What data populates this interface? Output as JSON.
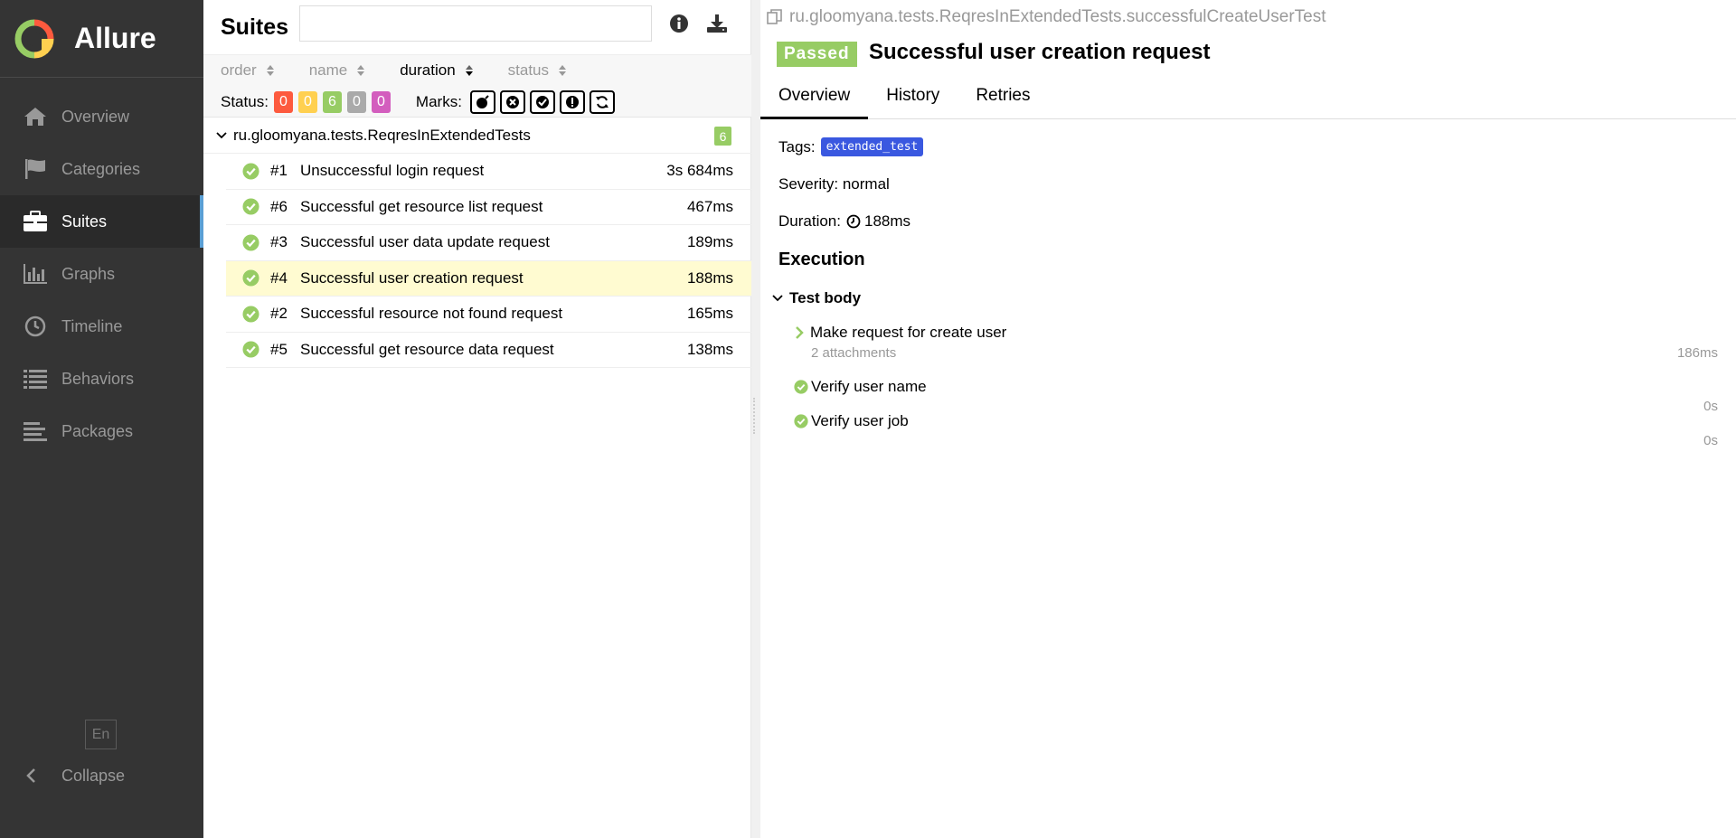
{
  "sidebar": {
    "brand": "Allure",
    "items": [
      {
        "label": "Overview",
        "icon": "home-icon"
      },
      {
        "label": "Categories",
        "icon": "flag-icon"
      },
      {
        "label": "Suites",
        "icon": "briefcase-icon",
        "active": true
      },
      {
        "label": "Graphs",
        "icon": "bar-chart-icon"
      },
      {
        "label": "Timeline",
        "icon": "clock-icon"
      },
      {
        "label": "Behaviors",
        "icon": "list-icon"
      },
      {
        "label": "Packages",
        "icon": "align-left-icon"
      }
    ],
    "language": "En",
    "collapse": "Collapse"
  },
  "suites": {
    "title": "Suites",
    "search_placeholder": "",
    "sort": {
      "order": "order",
      "name": "name",
      "duration": "duration",
      "status": "status"
    },
    "status_label": "Status:",
    "status_counts": [
      {
        "value": "0",
        "color": "#fd5a3e"
      },
      {
        "value": "0",
        "color": "#ffd050"
      },
      {
        "value": "6",
        "color": "#97cc64"
      },
      {
        "value": "0",
        "color": "#aaaaaa"
      },
      {
        "value": "0",
        "color": "#d35ebe"
      }
    ],
    "marks_label": "Marks:",
    "group": {
      "name": "ru.gloomyana.tests.ReqresInExtendedTests",
      "count": "6"
    },
    "tests": [
      {
        "num": "#1",
        "name": "Unsuccessful login request",
        "duration": "3s 684ms"
      },
      {
        "num": "#6",
        "name": "Successful get resource list request",
        "duration": "467ms"
      },
      {
        "num": "#3",
        "name": "Successful user data update request",
        "duration": "189ms"
      },
      {
        "num": "#4",
        "name": "Successful user creation request",
        "duration": "188ms",
        "selected": true
      },
      {
        "num": "#2",
        "name": "Successful resource not found request",
        "duration": "165ms"
      },
      {
        "num": "#5",
        "name": "Successful get resource data request",
        "duration": "138ms"
      }
    ]
  },
  "detail": {
    "full_name": "ru.gloomyana.tests.ReqresInExtendedTests.successfulCreateUserTest",
    "status": "Passed",
    "title": "Successful user creation request",
    "tabs": [
      "Overview",
      "History",
      "Retries"
    ],
    "tags_label": "Tags:",
    "tag": "extended_test",
    "severity": "Severity: normal",
    "duration_label": "Duration:",
    "duration": "188ms",
    "execution": "Execution",
    "test_body": "Test body",
    "steps": [
      {
        "name": "Make request for create user",
        "sub": "2 attachments",
        "duration": "186ms"
      },
      {
        "name": "Verify user name",
        "duration": "0s"
      },
      {
        "name": "Verify user job",
        "duration": "0s"
      }
    ]
  },
  "colors": {
    "passed": "#97cc64",
    "sidebar": "#343434",
    "accent": "#5a9fd4",
    "tag": "#3a58e0",
    "selected_row": "#fffbd1"
  }
}
